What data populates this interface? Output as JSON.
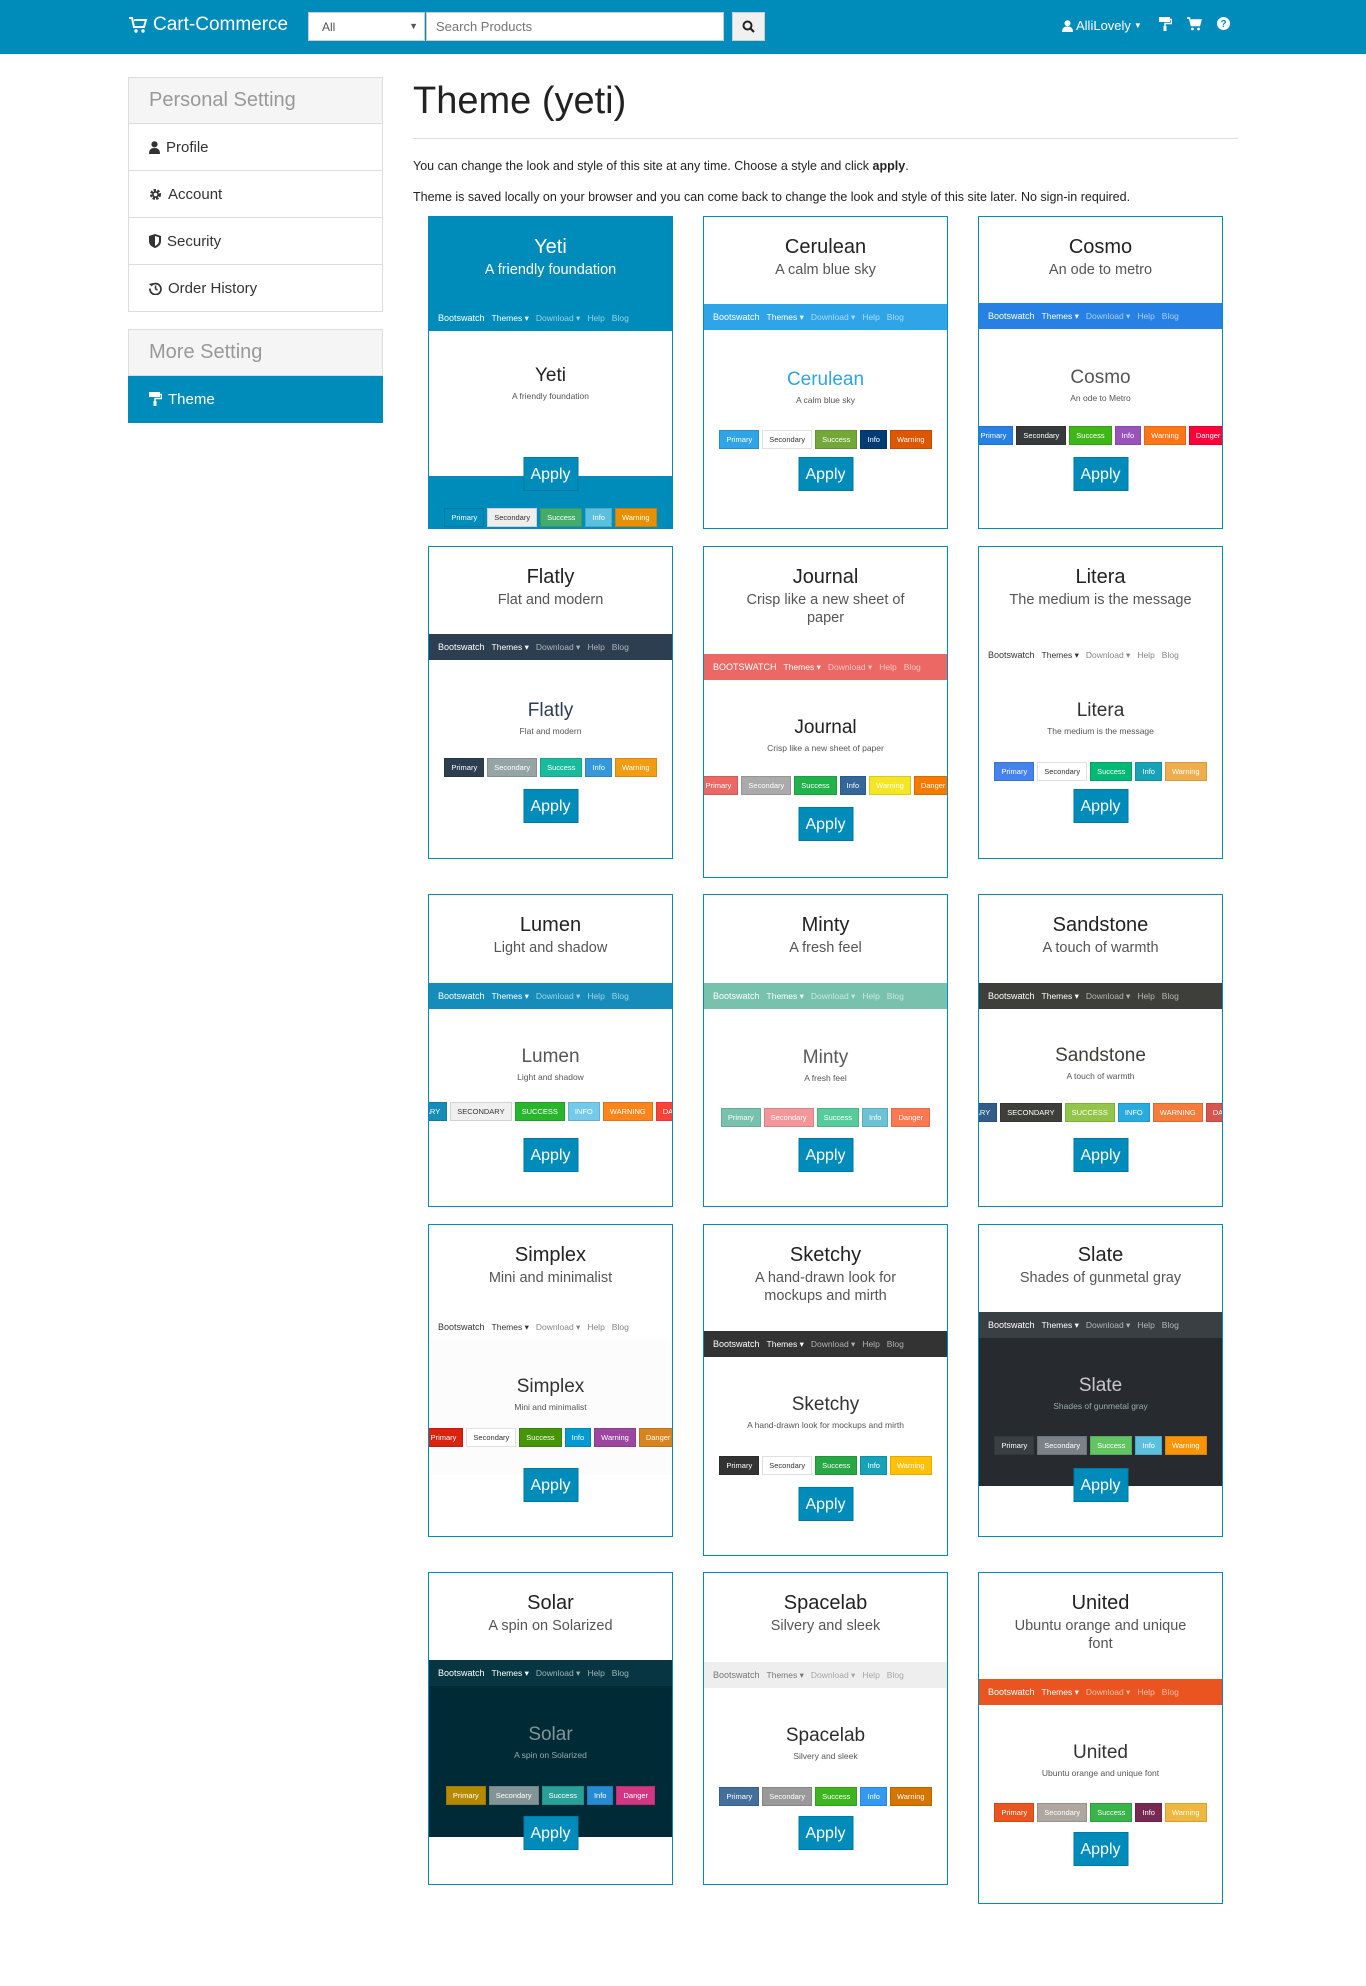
{
  "header": {
    "brand": "Cart-Commerce",
    "category": "All",
    "search_placeholder": "Search Products",
    "user": "AlliLovely"
  },
  "sidebar": {
    "personal_title": "Personal Setting",
    "personal_items": [
      {
        "label": "Profile",
        "icon": "user-icon"
      },
      {
        "label": "Account",
        "icon": "gear-icon"
      },
      {
        "label": "Security",
        "icon": "shield-icon"
      },
      {
        "label": "Order History",
        "icon": "history-icon"
      }
    ],
    "more_title": "More Setting",
    "more_items": [
      {
        "label": "Theme",
        "icon": "paint-roller-icon"
      }
    ]
  },
  "main": {
    "title": "Theme (yeti)",
    "intro1_pre": "You can change the look and style of this site at any time. Choose a style and click ",
    "intro1_bold": "apply",
    "intro1_post": ".",
    "intro2": "Theme is saved locally on your browser and you can come back to change the look and style of this site later. No sign-in required.",
    "apply_label": "Apply"
  },
  "preview_nav": {
    "brand": "Bootswatch",
    "themes": "Themes ▾",
    "download": "Download ▾",
    "help": "Help",
    "blog": "Blog"
  },
  "themes": [
    {
      "name": "Yeti",
      "desc": "A friendly foundation",
      "nav_bg": "#008cba",
      "body_bg": "#ffffff",
      "title_color": "#222222",
      "buttons": [
        {
          "label": "Primary",
          "bg": "#008cba"
        },
        {
          "label": "Secondary",
          "bg": "#eeeeee",
          "fg": "#333"
        },
        {
          "label": "Success",
          "bg": "#43ac6a"
        },
        {
          "label": "Info",
          "bg": "#5bc0de"
        },
        {
          "label": "Warning",
          "bg": "#e99002"
        }
      ]
    },
    {
      "name": "Cerulean",
      "desc": "A calm blue sky",
      "nav_bg": "#2fa4e7",
      "body_bg": "#ffffff",
      "title_color": "#2fa4e7",
      "buttons": [
        {
          "label": "Primary",
          "bg": "#2fa4e7"
        },
        {
          "label": "Secondary",
          "bg": "#ffffff",
          "fg": "#333"
        },
        {
          "label": "Success",
          "bg": "#73a839"
        },
        {
          "label": "Info",
          "bg": "#033c73"
        },
        {
          "label": "Warning",
          "bg": "#dd5600"
        }
      ]
    },
    {
      "name": "Cosmo",
      "desc": "An ode to metro",
      "preview_desc": "An ode to Metro",
      "nav_bg": "#2780e3",
      "body_bg": "#ffffff",
      "title_color": "#555555",
      "buttons": [
        {
          "label": "Primary",
          "bg": "#2780e3"
        },
        {
          "label": "Secondary",
          "bg": "#373a3c"
        },
        {
          "label": "Success",
          "bg": "#3fb618"
        },
        {
          "label": "Info",
          "bg": "#9954bb"
        },
        {
          "label": "Warning",
          "bg": "#ff7518"
        },
        {
          "label": "Danger",
          "bg": "#ff0039"
        }
      ]
    },
    {
      "name": "Flatly",
      "desc": "Flat and modern",
      "nav_bg": "#2c3e50",
      "body_bg": "#ffffff",
      "title_color": "#2c3e50",
      "buttons": [
        {
          "label": "Primary",
          "bg": "#2c3e50"
        },
        {
          "label": "Secondary",
          "bg": "#95a5a6"
        },
        {
          "label": "Success",
          "bg": "#18bc9c"
        },
        {
          "label": "Info",
          "bg": "#3498db"
        },
        {
          "label": "Warning",
          "bg": "#f39c12"
        }
      ]
    },
    {
      "name": "Journal",
      "desc": "Crisp like a new sheet of paper",
      "nav_bg": "#eb6864",
      "body_bg": "#ffffff",
      "title_color": "#222222",
      "nav_brand": "BOOTSWATCH",
      "buttons": [
        {
          "label": "Primary",
          "bg": "#eb6864"
        },
        {
          "label": "Secondary",
          "bg": "#aaaaaa"
        },
        {
          "label": "Success",
          "bg": "#22b24c"
        },
        {
          "label": "Info",
          "bg": "#336699"
        },
        {
          "label": "Warning",
          "bg": "#f5e625"
        },
        {
          "label": "Danger",
          "bg": "#f57a00"
        }
      ]
    },
    {
      "name": "Litera",
      "desc": "The medium is the message",
      "nav_bg": "#ffffff",
      "nav_fg": "#333",
      "body_bg": "#ffffff",
      "title_color": "#333333",
      "buttons": [
        {
          "label": "Primary",
          "bg": "#4582ec"
        },
        {
          "label": "Secondary",
          "bg": "#ffffff",
          "fg": "#333"
        },
        {
          "label": "Success",
          "bg": "#02b875"
        },
        {
          "label": "Info",
          "bg": "#17a2b8"
        },
        {
          "label": "Warning",
          "bg": "#f0ad4e"
        }
      ]
    },
    {
      "name": "Lumen",
      "desc": "Light and shadow",
      "nav_bg": "#158cba",
      "body_bg": "#ffffff",
      "title_color": "#555555",
      "buttons": [
        {
          "label": "PRIMARY",
          "bg": "#158cba"
        },
        {
          "label": "SECONDARY",
          "bg": "#f0f0f0",
          "fg": "#333"
        },
        {
          "label": "SUCCESS",
          "bg": "#28b62c"
        },
        {
          "label": "INFO",
          "bg": "#75caeb"
        },
        {
          "label": "WARNING",
          "bg": "#ff851b"
        },
        {
          "label": "DANGER",
          "bg": "#ff4136"
        }
      ]
    },
    {
      "name": "Minty",
      "desc": "A fresh feel",
      "nav_bg": "#78c2ad",
      "body_bg": "#ffffff",
      "title_color": "#5a5a5a",
      "buttons": [
        {
          "label": "Primary",
          "bg": "#78c2ad"
        },
        {
          "label": "Secondary",
          "bg": "#f3969a"
        },
        {
          "label": "Success",
          "bg": "#56cc9d"
        },
        {
          "label": "Info",
          "bg": "#6cc3d5"
        },
        {
          "label": "Danger",
          "bg": "#ff7851"
        }
      ]
    },
    {
      "name": "Sandstone",
      "desc": "A touch of warmth",
      "nav_bg": "#3e3f3a",
      "body_bg": "#ffffff",
      "title_color": "#3e3f3a",
      "buttons": [
        {
          "label": "PRIMARY",
          "bg": "#325d88"
        },
        {
          "label": "SECONDARY",
          "bg": "#3e3f3a"
        },
        {
          "label": "SUCCESS",
          "bg": "#93c54b"
        },
        {
          "label": "INFO",
          "bg": "#29abe0"
        },
        {
          "label": "WARNING",
          "bg": "#f47c3c"
        },
        {
          "label": "DANGER",
          "bg": "#d9534f"
        }
      ]
    },
    {
      "name": "Simplex",
      "desc": "Mini and minimalist",
      "nav_bg": "#ffffff",
      "nav_fg": "#333",
      "body_bg": "#fcfcfc",
      "title_color": "#333333",
      "buttons": [
        {
          "label": "Primary",
          "bg": "#d9230f"
        },
        {
          "label": "Secondary",
          "bg": "#ffffff",
          "fg": "#333"
        },
        {
          "label": "Success",
          "bg": "#469408"
        },
        {
          "label": "Info",
          "bg": "#029acf"
        },
        {
          "label": "Warning",
          "bg": "#9b479f"
        },
        {
          "label": "Danger",
          "bg": "#d9831f"
        }
      ]
    },
    {
      "name": "Sketchy",
      "desc": "A hand-drawn look for mockups and mirth",
      "nav_bg": "#333333",
      "body_bg": "#ffffff",
      "title_color": "#333333",
      "buttons": [
        {
          "label": "Primary",
          "bg": "#333333"
        },
        {
          "label": "Secondary",
          "bg": "#ffffff",
          "fg": "#333"
        },
        {
          "label": "Success",
          "bg": "#28a745"
        },
        {
          "label": "Info",
          "bg": "#17a2b8"
        },
        {
          "label": "Warning",
          "bg": "#ffc107"
        }
      ]
    },
    {
      "name": "Slate",
      "desc": "Shades of gunmetal gray",
      "nav_bg": "#3a3f44",
      "body_bg": "#272b30",
      "title_color": "#c8c8c8",
      "buttons": [
        {
          "label": "Primary",
          "bg": "#3a3f44"
        },
        {
          "label": "Secondary",
          "bg": "#7a8288"
        },
        {
          "label": "Success",
          "bg": "#62c462"
        },
        {
          "label": "Info",
          "bg": "#5bc0de"
        },
        {
          "label": "Warning",
          "bg": "#f89406"
        }
      ]
    },
    {
      "name": "Solar",
      "desc": "A spin on Solarized",
      "nav_bg": "#073642",
      "body_bg": "#002b36",
      "title_color": "#839496",
      "buttons": [
        {
          "label": "Primary",
          "bg": "#b58900"
        },
        {
          "label": "Secondary",
          "bg": "#839496"
        },
        {
          "label": "Success",
          "bg": "#2aa198"
        },
        {
          "label": "Info",
          "bg": "#268bd2"
        },
        {
          "label": "Danger",
          "bg": "#d33682"
        }
      ]
    },
    {
      "name": "Spacelab",
      "desc": "Silvery and sleek",
      "nav_bg": "#eeeeee",
      "nav_fg": "#777",
      "body_bg": "#ffffff",
      "title_color": "#2d2d2d",
      "buttons": [
        {
          "label": "Primary",
          "bg": "#446e9b"
        },
        {
          "label": "Secondary",
          "bg": "#999999"
        },
        {
          "label": "Success",
          "bg": "#3cb521"
        },
        {
          "label": "Info",
          "bg": "#3399f3"
        },
        {
          "label": "Warning",
          "bg": "#d47500"
        }
      ]
    },
    {
      "name": "United",
      "desc": "Ubuntu orange and unique font",
      "nav_bg": "#e95420",
      "body_bg": "#ffffff",
      "title_color": "#333333",
      "buttons": [
        {
          "label": "Primary",
          "bg": "#e95420"
        },
        {
          "label": "Secondary",
          "bg": "#aea79f"
        },
        {
          "label": "Success",
          "bg": "#38b44a"
        },
        {
          "label": "Info",
          "bg": "#772953"
        },
        {
          "label": "Warning",
          "bg": "#efb73e"
        }
      ]
    }
  ]
}
